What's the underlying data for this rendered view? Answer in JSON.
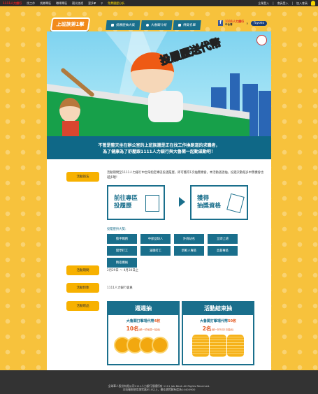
{
  "topbar": {
    "brand": "1111人力銀行",
    "links": [
      "找工作",
      "找職專區",
      "職場專區",
      "觀光旅遊",
      "更多▼"
    ],
    "promo": "免費履歷分析",
    "right": [
      "企業登入",
      "會員登入",
      "加入會員"
    ]
  },
  "header": {
    "logo": "上班族第1擊",
    "nav": [
      "投履歷抽大獎",
      "大魯閣介紹",
      "得獎名單"
    ],
    "partners": {
      "p1111": "1111人力銀行",
      "p1111_sub": "中台灣",
      "toyo": "Toyoko",
      "x": "×"
    }
  },
  "banner": {
    "title": "投履歷送代幣"
  },
  "intro": [
    "不管是整天坐在辦公室的上班族還是正在找工作換跑道的求職者，",
    "為了健康為了舒壓跟1111人力銀行與大魯閣一起動滋動吧！"
  ],
  "sections": {
    "method": {
      "label": "活動辦法",
      "text": "活動期間至1111人力銀行中台灣指定專區投遞履歷，即可獲得1次抽獎機會。本活動週週抽，投遞次數越多中獎機會也越多喔！",
      "step1": [
        "前往專區",
        "投履歷"
      ],
      "step2": [
        "獲得",
        "抽獎資格"
      ],
      "tags_label": "投履歷拚大獎：",
      "tags": [
        "猿手職務",
        "中部品缺人",
        "外商站名",
        "立即上班",
        "開學打工",
        "滿職打工",
        "新鮮人專區",
        "高薪專區",
        "精密機械"
      ]
    },
    "period": {
      "label": "活動期間",
      "text": "2月29日 ～ 4月30日止"
    },
    "target": {
      "label": "活動對象",
      "text": "1111人力銀行會員"
    },
    "prizes": {
      "label": "活動贈品",
      "items": [
        {
          "title": "週週抽",
          "desc": "大魯閣打擊場代幣",
          "qty": "4枚",
          "winners": "10名",
          "note": "(統一於每週一抽出)"
        },
        {
          "title": "活動結束抽",
          "desc": "大魯閣打擊場代幣",
          "qty": "50枚",
          "winners": "2名",
          "note": "(統一於5月2日抽出)"
        }
      ]
    }
  },
  "footer": [
    "全球華人股份有限公司1111人力銀行版權所有 1111 Job Bank All Rights Reserved.",
    "本站僅限使用瀏覽器IE10以上，最佳瀏覽解析度為1440X900"
  ]
}
